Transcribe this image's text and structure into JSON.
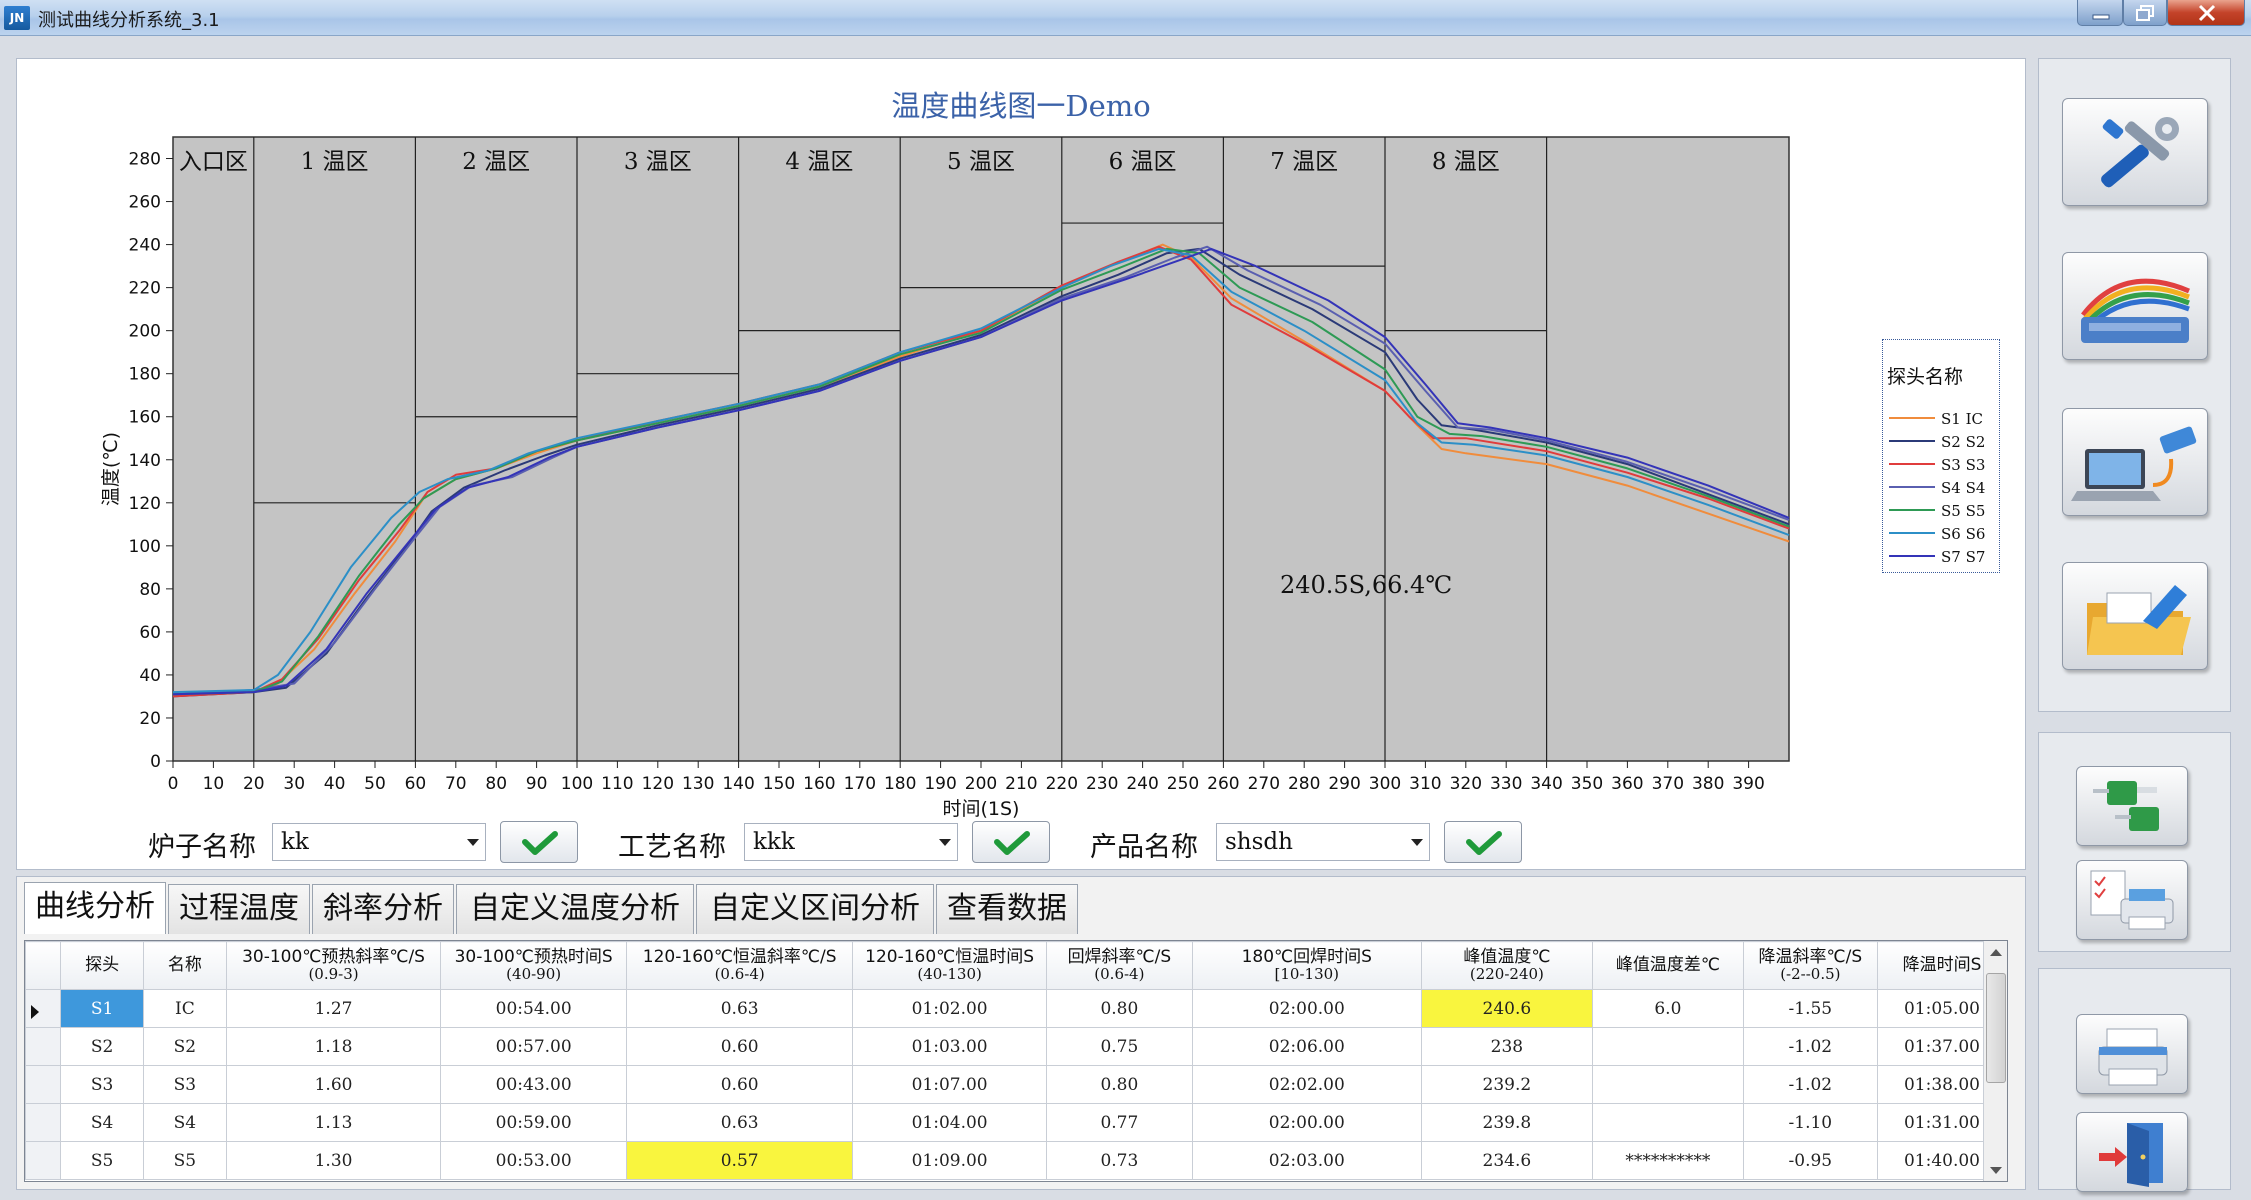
{
  "window": {
    "icon_text": "JN",
    "title": "测试曲线分析系统_3.1"
  },
  "chart_data": {
    "type": "line",
    "title": "温度曲线图一Demo",
    "xlabel": "时间(1S)",
    "ylabel": "温度(℃)",
    "xlim": [
      0,
      400
    ],
    "ylim": [
      0,
      290
    ],
    "x_ticks": [
      0,
      10,
      20,
      30,
      40,
      50,
      60,
      70,
      80,
      90,
      100,
      110,
      120,
      130,
      140,
      150,
      160,
      170,
      180,
      190,
      200,
      210,
      220,
      230,
      240,
      250,
      260,
      270,
      280,
      290,
      300,
      310,
      320,
      330,
      340,
      350,
      360,
      370,
      380,
      390
    ],
    "y_ticks": [
      0,
      20,
      40,
      60,
      80,
      100,
      120,
      140,
      160,
      180,
      200,
      220,
      240,
      260,
      280
    ],
    "zones": [
      {
        "label": "入口区",
        "x_start": 0,
        "x_end": 20,
        "limit": null
      },
      {
        "label": "1 温区",
        "x_start": 20,
        "x_end": 60,
        "limit": 120
      },
      {
        "label": "2 温区",
        "x_start": 60,
        "x_end": 100,
        "limit": 160
      },
      {
        "label": "3 温区",
        "x_start": 100,
        "x_end": 140,
        "limit": 180
      },
      {
        "label": "4 温区",
        "x_start": 140,
        "x_end": 180,
        "limit": 200
      },
      {
        "label": "5 温区",
        "x_start": 180,
        "x_end": 220,
        "limit": 220
      },
      {
        "label": "6 温区",
        "x_start": 220,
        "x_end": 260,
        "limit": 250
      },
      {
        "label": "7 温区",
        "x_start": 260,
        "x_end": 300,
        "limit": 230
      },
      {
        "label": "8 温区",
        "x_start": 300,
        "x_end": 340,
        "limit": 200
      },
      {
        "label": "",
        "x_start": 340,
        "x_end": 400,
        "limit": null
      }
    ],
    "annotation": "240.5S,66.4℃",
    "legend_title": "探头名称",
    "legend_position": "right",
    "series": [
      {
        "name": "S1 IC",
        "color": "#f08c3c",
        "points": [
          [
            0,
            31
          ],
          [
            20,
            32
          ],
          [
            26,
            36
          ],
          [
            35,
            52
          ],
          [
            45,
            78
          ],
          [
            55,
            102
          ],
          [
            62,
            122
          ],
          [
            70,
            131
          ],
          [
            80,
            136
          ],
          [
            90,
            143
          ],
          [
            100,
            149
          ],
          [
            120,
            157
          ],
          [
            140,
            165
          ],
          [
            160,
            174
          ],
          [
            180,
            188
          ],
          [
            200,
            200
          ],
          [
            220,
            220
          ],
          [
            232,
            230
          ],
          [
            245,
            240
          ],
          [
            252,
            234
          ],
          [
            262,
            215
          ],
          [
            280,
            195
          ],
          [
            300,
            172
          ],
          [
            308,
            156
          ],
          [
            314,
            145
          ],
          [
            320,
            143
          ],
          [
            340,
            138
          ],
          [
            360,
            128
          ],
          [
            380,
            115
          ],
          [
            400,
            102
          ]
        ]
      },
      {
        "name": "S2 S2",
        "color": "#2b3a78",
        "points": [
          [
            0,
            30
          ],
          [
            20,
            32
          ],
          [
            28,
            34
          ],
          [
            38,
            50
          ],
          [
            48,
            76
          ],
          [
            58,
            100
          ],
          [
            64,
            116
          ],
          [
            72,
            127
          ],
          [
            82,
            135
          ],
          [
            92,
            142
          ],
          [
            100,
            147
          ],
          [
            120,
            156
          ],
          [
            140,
            164
          ],
          [
            160,
            173
          ],
          [
            180,
            187
          ],
          [
            200,
            198
          ],
          [
            220,
            216
          ],
          [
            234,
            226
          ],
          [
            246,
            236
          ],
          [
            254,
            238
          ],
          [
            264,
            226
          ],
          [
            282,
            210
          ],
          [
            300,
            190
          ],
          [
            308,
            168
          ],
          [
            314,
            156
          ],
          [
            322,
            154
          ],
          [
            340,
            148
          ],
          [
            360,
            138
          ],
          [
            380,
            124
          ],
          [
            400,
            110
          ]
        ]
      },
      {
        "name": "S3 S3",
        "color": "#e03c3c",
        "points": [
          [
            0,
            30
          ],
          [
            20,
            32
          ],
          [
            27,
            38
          ],
          [
            36,
            57
          ],
          [
            46,
            84
          ],
          [
            56,
            107
          ],
          [
            63,
            125
          ],
          [
            70,
            133
          ],
          [
            80,
            136
          ],
          [
            90,
            144
          ],
          [
            100,
            149
          ],
          [
            120,
            158
          ],
          [
            140,
            166
          ],
          [
            160,
            175
          ],
          [
            180,
            190
          ],
          [
            200,
            200
          ],
          [
            220,
            221
          ],
          [
            234,
            232
          ],
          [
            244,
            239
          ],
          [
            252,
            233
          ],
          [
            262,
            212
          ],
          [
            280,
            194
          ],
          [
            300,
            172
          ],
          [
            306,
            160
          ],
          [
            312,
            150
          ],
          [
            320,
            150
          ],
          [
            340,
            144
          ],
          [
            360,
            134
          ],
          [
            380,
            122
          ],
          [
            400,
            108
          ]
        ]
      },
      {
        "name": "S4 S4",
        "color": "#5a5fb0",
        "points": [
          [
            0,
            31
          ],
          [
            20,
            33
          ],
          [
            30,
            36
          ],
          [
            40,
            55
          ],
          [
            50,
            80
          ],
          [
            60,
            104
          ],
          [
            66,
            118
          ],
          [
            74,
            128
          ],
          [
            84,
            132
          ],
          [
            94,
            141
          ],
          [
            100,
            146
          ],
          [
            120,
            155
          ],
          [
            140,
            163
          ],
          [
            160,
            172
          ],
          [
            180,
            186
          ],
          [
            200,
            197
          ],
          [
            220,
            215
          ],
          [
            236,
            225
          ],
          [
            248,
            234
          ],
          [
            256,
            239
          ],
          [
            266,
            228
          ],
          [
            284,
            212
          ],
          [
            300,
            194
          ],
          [
            310,
            172
          ],
          [
            318,
            155
          ],
          [
            326,
            154
          ],
          [
            340,
            149
          ],
          [
            360,
            139
          ],
          [
            380,
            126
          ],
          [
            400,
            112
          ]
        ]
      },
      {
        "name": "S5 S5",
        "color": "#2e9a55",
        "points": [
          [
            0,
            31
          ],
          [
            20,
            32
          ],
          [
            27,
            37
          ],
          [
            36,
            58
          ],
          [
            46,
            86
          ],
          [
            56,
            110
          ],
          [
            62,
            122
          ],
          [
            70,
            131
          ],
          [
            80,
            136
          ],
          [
            90,
            144
          ],
          [
            100,
            149
          ],
          [
            120,
            157
          ],
          [
            140,
            165
          ],
          [
            160,
            174
          ],
          [
            180,
            189
          ],
          [
            200,
            199
          ],
          [
            220,
            219
          ],
          [
            234,
            229
          ],
          [
            246,
            238
          ],
          [
            254,
            236
          ],
          [
            264,
            220
          ],
          [
            282,
            204
          ],
          [
            300,
            182
          ],
          [
            308,
            160
          ],
          [
            316,
            152
          ],
          [
            324,
            151
          ],
          [
            340,
            146
          ],
          [
            360,
            136
          ],
          [
            380,
            123
          ],
          [
            400,
            109
          ]
        ]
      },
      {
        "name": "S6 S6",
        "color": "#2c8fc7",
        "points": [
          [
            0,
            32
          ],
          [
            20,
            33
          ],
          [
            26,
            40
          ],
          [
            34,
            60
          ],
          [
            44,
            90
          ],
          [
            54,
            113
          ],
          [
            61,
            125
          ],
          [
            68,
            131
          ],
          [
            78,
            135
          ],
          [
            88,
            143
          ],
          [
            100,
            150
          ],
          [
            120,
            158
          ],
          [
            140,
            166
          ],
          [
            160,
            175
          ],
          [
            180,
            190
          ],
          [
            200,
            201
          ],
          [
            220,
            220
          ],
          [
            232,
            230
          ],
          [
            244,
            238
          ],
          [
            252,
            235
          ],
          [
            262,
            218
          ],
          [
            280,
            200
          ],
          [
            300,
            177
          ],
          [
            308,
            157
          ],
          [
            314,
            148
          ],
          [
            322,
            147
          ],
          [
            340,
            142
          ],
          [
            360,
            132
          ],
          [
            380,
            119
          ],
          [
            400,
            105
          ]
        ]
      },
      {
        "name": "S7 S7",
        "color": "#3434b8",
        "points": [
          [
            0,
            31
          ],
          [
            20,
            32
          ],
          [
            28,
            35
          ],
          [
            38,
            52
          ],
          [
            48,
            78
          ],
          [
            58,
            101
          ],
          [
            65,
            117
          ],
          [
            73,
            127
          ],
          [
            83,
            132
          ],
          [
            93,
            141
          ],
          [
            100,
            146
          ],
          [
            120,
            155
          ],
          [
            140,
            163
          ],
          [
            160,
            172
          ],
          [
            180,
            186
          ],
          [
            200,
            197
          ],
          [
            220,
            214
          ],
          [
            236,
            224
          ],
          [
            248,
            232
          ],
          [
            257,
            238
          ],
          [
            268,
            230
          ],
          [
            286,
            214
          ],
          [
            300,
            197
          ],
          [
            310,
            175
          ],
          [
            318,
            157
          ],
          [
            326,
            155
          ],
          [
            340,
            150
          ],
          [
            360,
            141
          ],
          [
            380,
            128
          ],
          [
            400,
            113
          ]
        ]
      }
    ]
  },
  "selectors": {
    "furnace_label": "炉子名称",
    "furnace_value": "kk",
    "process_label": "工艺名称",
    "process_value": "kkk",
    "product_label": "产品名称",
    "product_value": "shsdh"
  },
  "tabs": [
    "曲线分析",
    "过程温度",
    "斜率分析",
    "自定义温度分析",
    "自定义区间分析",
    "查看数据"
  ],
  "table": {
    "headers": [
      {
        "title": "探头",
        "sub": ""
      },
      {
        "title": "名称",
        "sub": ""
      },
      {
        "title": "30-100℃预热斜率℃/S",
        "sub": "(0.9-3)"
      },
      {
        "title": "30-100℃预热时间S",
        "sub": "(40-90)"
      },
      {
        "title": "120-160℃恒温斜率℃/S",
        "sub": "(0.6-4)"
      },
      {
        "title": "120-160℃恒温时间S",
        "sub": "(40-130)"
      },
      {
        "title": "回焊斜率℃/S",
        "sub": "(0.6-4)"
      },
      {
        "title": "180℃回焊时间S",
        "sub": "[10-130)"
      },
      {
        "title": "峰值温度℃",
        "sub": "(220-240)"
      },
      {
        "title": "峰值温度差℃",
        "sub": ""
      },
      {
        "title": "降温斜率℃/S",
        "sub": "(-2--0.5)"
      },
      {
        "title": "降温时间S",
        "sub": ""
      }
    ],
    "rows": [
      [
        "S1",
        "IC",
        "1.27",
        "00:54.00",
        "0.63",
        "01:02.00",
        "0.80",
        "02:00.00",
        "240.6",
        "6.0",
        "-1.55",
        "01:05.00"
      ],
      [
        "S2",
        "S2",
        "1.18",
        "00:57.00",
        "0.60",
        "01:03.00",
        "0.75",
        "02:06.00",
        "238",
        "",
        "-1.02",
        "01:37.00"
      ],
      [
        "S3",
        "S3",
        "1.60",
        "00:43.00",
        "0.60",
        "01:07.00",
        "0.80",
        "02:02.00",
        "239.2",
        "",
        "-1.02",
        "01:38.00"
      ],
      [
        "S4",
        "S4",
        "1.13",
        "00:59.00",
        "0.63",
        "01:04.00",
        "0.77",
        "02:00.00",
        "239.8",
        "",
        "-1.10",
        "01:31.00"
      ],
      [
        "S5",
        "S5",
        "1.30",
        "00:53.00",
        "0.57",
        "01:09.00",
        "0.73",
        "02:03.00",
        "234.6",
        "**********",
        "-0.95",
        "01:40.00"
      ]
    ],
    "highlight_color": "#f9f53e",
    "selected_color": "#3e98dc"
  },
  "toolbar": {
    "icons": [
      "settings-tools-icon",
      "probe-cable-icon",
      "laptop-connect-icon",
      "open-folder-icon",
      "thermocouple-icon",
      "report-print-icon",
      "printer-icon",
      "exit-door-icon"
    ]
  }
}
